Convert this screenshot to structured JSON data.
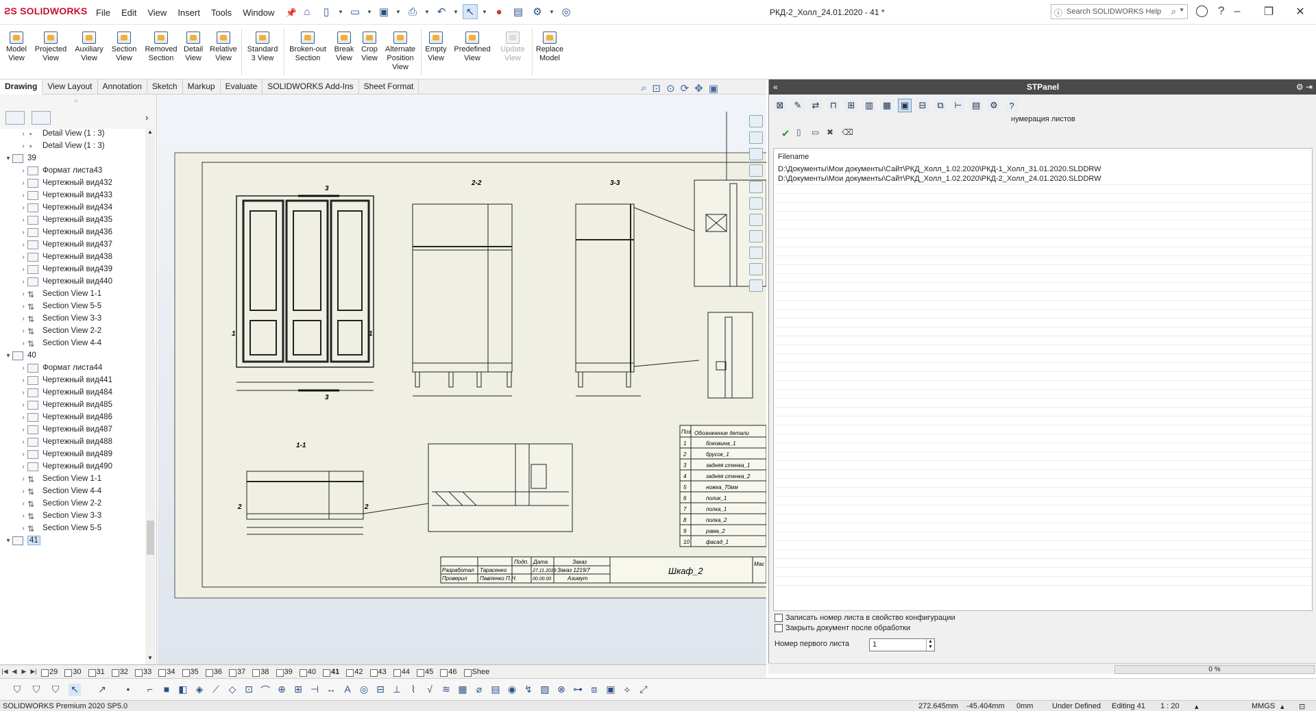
{
  "app": {
    "logo_text": "SOLIDWORKS",
    "doc_title": "РКД-2_Холл_24.01.2020 - 41 *",
    "search_placeholder": "Search SOLIDWORKS Help"
  },
  "menu": [
    "File",
    "Edit",
    "View",
    "Insert",
    "Tools",
    "Window"
  ],
  "ribbon": [
    {
      "label": "Model\nView",
      "enabled": true
    },
    {
      "label": "Projected\nView",
      "enabled": true
    },
    {
      "label": "Auxiliary\nView",
      "enabled": true
    },
    {
      "label": "Section\nView",
      "enabled": true
    },
    {
      "label": "Removed\nSection",
      "enabled": true
    },
    {
      "label": "Detail\nView",
      "enabled": true
    },
    {
      "label": "Relative\nView",
      "enabled": true
    },
    {
      "label": "Standard\n3 View",
      "enabled": true
    },
    {
      "label": "Broken-out\nSection",
      "enabled": true
    },
    {
      "label": "Break\nView",
      "enabled": true
    },
    {
      "label": "Crop\nView",
      "enabled": true
    },
    {
      "label": "Alternate\nPosition\nView",
      "enabled": true
    },
    {
      "label": "Empty\nView",
      "enabled": true
    },
    {
      "label": "Predefined\nView",
      "enabled": true
    },
    {
      "label": "Update\nView",
      "enabled": false
    },
    {
      "label": "Replace\nModel",
      "enabled": true
    }
  ],
  "tabs": [
    "Drawing",
    "View Layout",
    "Annotation",
    "Sketch",
    "Markup",
    "Evaluate",
    "SOLIDWORKS Add-Ins",
    "Sheet Format"
  ],
  "active_tab": "Drawing",
  "tree": [
    {
      "label": "Detail View (1 : 3)",
      "kind": "detail",
      "level": 1
    },
    {
      "label": "Detail View (1 : 3)",
      "kind": "detail",
      "level": 1
    },
    {
      "label": "39",
      "kind": "sheet",
      "level": 0,
      "expanded": true
    },
    {
      "label": "Формат листа43",
      "kind": "format",
      "level": 1
    },
    {
      "label": "Чертежный вид432",
      "kind": "view",
      "level": 1
    },
    {
      "label": "Чертежный вид433",
      "kind": "view",
      "level": 1
    },
    {
      "label": "Чертежный вид434",
      "kind": "view",
      "level": 1
    },
    {
      "label": "Чертежный вид435",
      "kind": "view",
      "level": 1
    },
    {
      "label": "Чертежный вид436",
      "kind": "view",
      "level": 1
    },
    {
      "label": "Чертежный вид437",
      "kind": "view",
      "level": 1
    },
    {
      "label": "Чертежный вид438",
      "kind": "view",
      "level": 1
    },
    {
      "label": "Чертежный вид439",
      "kind": "view",
      "level": 1
    },
    {
      "label": "Чертежный вид440",
      "kind": "view",
      "level": 1
    },
    {
      "label": "Section View 1-1",
      "kind": "section",
      "level": 1
    },
    {
      "label": "Section View 5-5",
      "kind": "section",
      "level": 1
    },
    {
      "label": "Section View 3-3",
      "kind": "section",
      "level": 1
    },
    {
      "label": "Section View 2-2",
      "kind": "section",
      "level": 1
    },
    {
      "label": "Section View 4-4",
      "kind": "section",
      "level": 1
    },
    {
      "label": "40",
      "kind": "sheet",
      "level": 0,
      "expanded": true
    },
    {
      "label": "Формат листа44",
      "kind": "format",
      "level": 1
    },
    {
      "label": "Чертежный вид441",
      "kind": "view",
      "level": 1
    },
    {
      "label": "Чертежный вид484",
      "kind": "view",
      "level": 1
    },
    {
      "label": "Чертежный вид485",
      "kind": "view",
      "level": 1
    },
    {
      "label": "Чертежный вид486",
      "kind": "view",
      "level": 1
    },
    {
      "label": "Чертежный вид487",
      "kind": "view",
      "level": 1
    },
    {
      "label": "Чертежный вид488",
      "kind": "view",
      "level": 1
    },
    {
      "label": "Чертежный вид489",
      "kind": "view",
      "level": 1
    },
    {
      "label": "Чертежный вид490",
      "kind": "view",
      "level": 1
    },
    {
      "label": "Section View 1-1",
      "kind": "section",
      "level": 1
    },
    {
      "label": "Section View 4-4",
      "kind": "section",
      "level": 1
    },
    {
      "label": "Section View 2-2",
      "kind": "section",
      "level": 1
    },
    {
      "label": "Section View 3-3",
      "kind": "section",
      "level": 1
    },
    {
      "label": "Section View 5-5",
      "kind": "section",
      "level": 1
    },
    {
      "label": "41",
      "kind": "sheet",
      "level": 0,
      "expanded": true,
      "selected": true
    }
  ],
  "drawing": {
    "section_2_2": "2-2",
    "section_3_3": "3-3",
    "section_1_1": "1-1",
    "markers": {
      "three": "3",
      "one": "1",
      "two": "2"
    },
    "bom_header": [
      "Поз",
      "Обозначение детали"
    ],
    "bom": [
      {
        "pos": "1",
        "name": "боковина_1"
      },
      {
        "pos": "2",
        "name": "брусок_1"
      },
      {
        "pos": "3",
        "name": "задняя стенка_1"
      },
      {
        "pos": "4",
        "name": "задняя стенка_2"
      },
      {
        "pos": "5",
        "name": "ножка_70мм"
      },
      {
        "pos": "6",
        "name": "полик_1"
      },
      {
        "pos": "7",
        "name": "полка_1"
      },
      {
        "pos": "8",
        "name": "полка_2"
      },
      {
        "pos": "9",
        "name": "рама_2"
      },
      {
        "pos": "10",
        "name": "фасад_1"
      }
    ],
    "title_block": {
      "row1": [
        "Разработал",
        "Тарасенко",
        "",
        "27.11.2019"
      ],
      "row2": [
        "Проверил",
        "Павленко П.Н.",
        "",
        "00.00.00"
      ],
      "hdr": [
        "Подп.",
        "Дата",
        "Заказ"
      ],
      "order": "Заказ 1219/7",
      "customer": "Азимут",
      "name": "Шкаф_2",
      "mass": "Мас"
    }
  },
  "panel": {
    "title": "STPanel",
    "subtitle": "нумерация листов",
    "list_header": "Filename",
    "files": [
      "D:\\Документы\\Мои документы\\Сайт\\РКД_Холл_1.02.2020\\РКД-1_Холл_31.01.2020.SLDDRW",
      "D:\\Документы\\Мои документы\\Сайт\\РКД_Холл_1.02.2020\\РКД-2_Холл_24.01.2020.SLDDRW"
    ],
    "opt_write": "Записать номер листа в свойство конфигурации",
    "opt_close": "Закрыть документ после обработки",
    "first_label": "Номер первого листа",
    "first_value": "1",
    "progress": "0 %"
  },
  "sheet_tabs": [
    "29",
    "30",
    "31",
    "32",
    "33",
    "34",
    "35",
    "36",
    "37",
    "38",
    "39",
    "40",
    "41",
    "42",
    "43",
    "44",
    "45",
    "46",
    "Shee"
  ],
  "active_sheet": "41",
  "status": {
    "product": "SOLIDWORKS Premium 2020 SP5.0",
    "x": "272.645mm",
    "y": "-45.404mm",
    "z": "0mm",
    "state": "Under Defined",
    "editing": "Editing 41",
    "scale": "1 : 20",
    "units": "MMGS"
  }
}
